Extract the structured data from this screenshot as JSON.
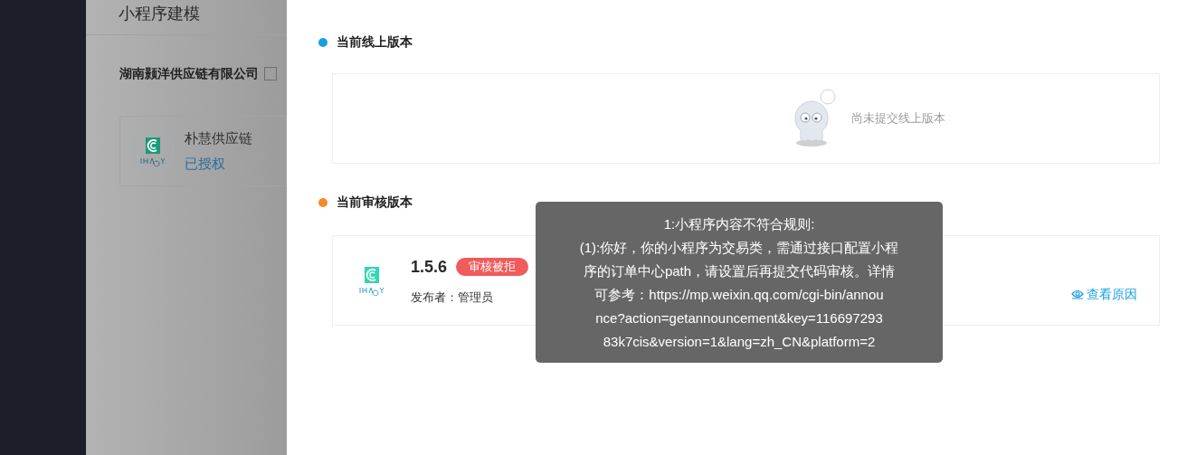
{
  "side_panel": {
    "title": "小程序建模",
    "company": "湖南颢洋供应链有限公司",
    "app": {
      "name": "朴慧供应链",
      "status": "已授权"
    }
  },
  "sections": [
    {
      "title": "当前线上版本",
      "color": "#1a9ee0",
      "kind": "empty",
      "empty_text": "尚未提交线上版本"
    },
    {
      "title": "当前审核版本",
      "color": "#f5892a",
      "kind": "version",
      "version": "1.5.6",
      "badge": "审核被拒",
      "publisher": "发布者：管理员",
      "link": "查看原因"
    }
  ],
  "tooltip": {
    "title": "1:小程序内容不符合规则:",
    "body_lines": [
      "(1):你好，你的小程序为交易类，需通过接口配置小程",
      "序的订单中心path，请设置后再提交代码审核。详情",
      "可参考：https://mp.weixin.qq.com/cgi-bin/annou",
      "nce?action=getannouncement&key=116697293",
      "83k7cis&version=1&lang=zh_CN&platform=2"
    ]
  }
}
